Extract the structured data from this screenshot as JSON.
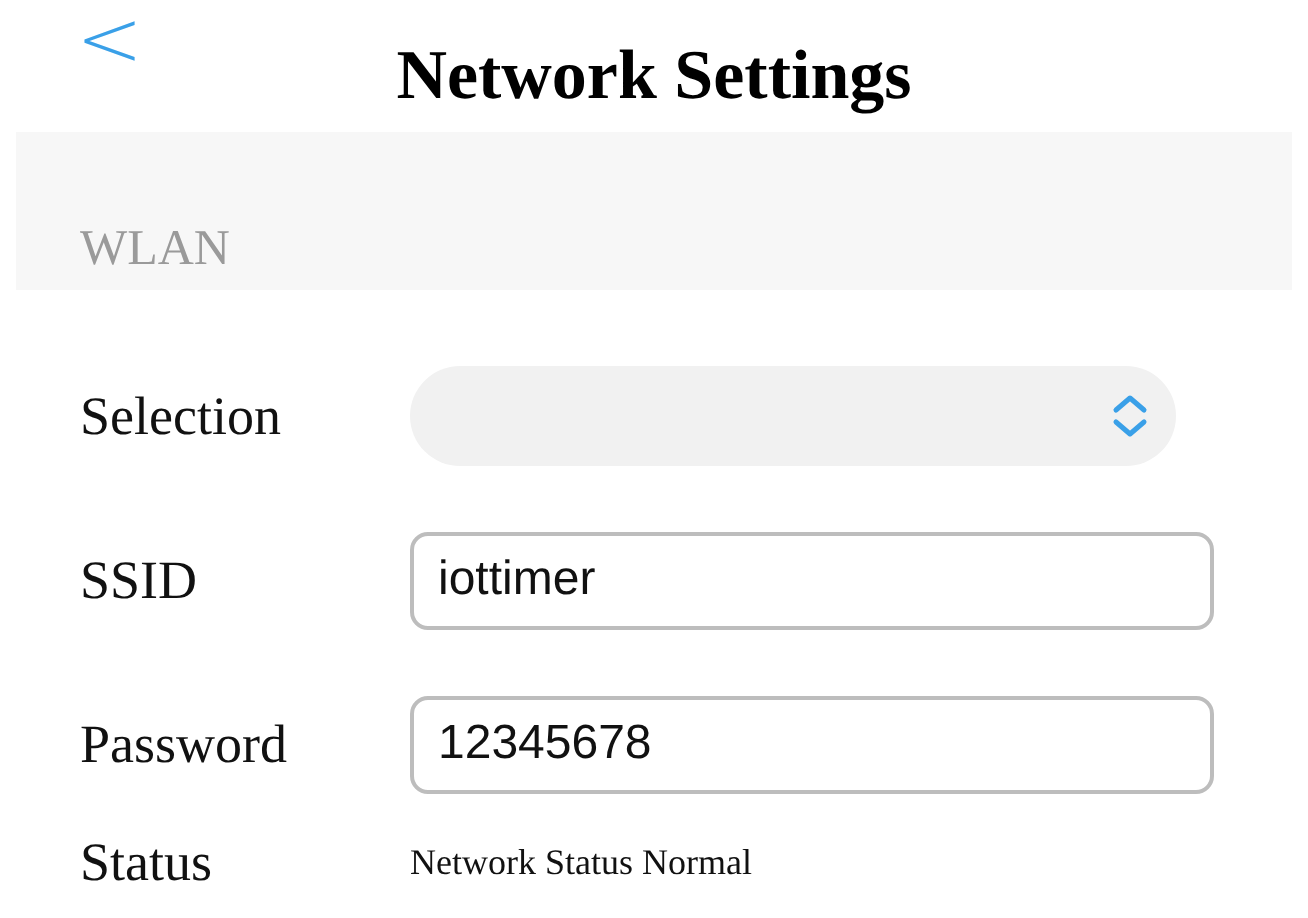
{
  "header": {
    "back_icon": "<",
    "title": "Network Settings"
  },
  "section": {
    "title": "WLAN"
  },
  "fields": [
    {
      "kind": "select",
      "label": "Selection"
    },
    {
      "kind": "text",
      "label": "SSID",
      "value": "iottimer"
    },
    {
      "kind": "text",
      "label": "Password",
      "value": "12345678"
    },
    {
      "kind": "status",
      "label": "Status",
      "value": "Network Status Normal"
    }
  ]
}
